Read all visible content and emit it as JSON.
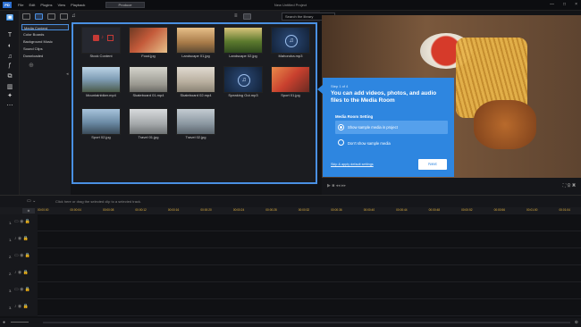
{
  "app": {
    "logo": "PD",
    "menu": [
      "File",
      "Edit",
      "Plugins",
      "View",
      "Playback"
    ],
    "produce_label": "Produce",
    "project_title": "New Untitled Project",
    "window_controls": [
      "—",
      "□",
      "×"
    ]
  },
  "library": {
    "search_placeholder": "Search the library",
    "rooms": [
      "Media Content",
      "Color Boards",
      "Background Music",
      "Sound Clips",
      "Downloaded"
    ],
    "selected_room": "Media Content",
    "items": [
      {
        "name": "Stock Content",
        "kind": "stock"
      },
      {
        "name": "Food.jpg",
        "kind": "image",
        "color": "#a84a32"
      },
      {
        "name": "Landscape 01.jpg",
        "kind": "image",
        "color": "#c79a5e"
      },
      {
        "name": "Landscape 02.jpg",
        "kind": "image",
        "color": "#6f8a3e"
      },
      {
        "name": "Mahoroba.mp3",
        "kind": "audio"
      },
      {
        "name": "Mountainbiker.mp4",
        "kind": "video",
        "color": "#8fb0c8"
      },
      {
        "name": "Skateboard 01.mp4",
        "kind": "video",
        "color": "#b9b9b0"
      },
      {
        "name": "Skateboard 02.mp4",
        "kind": "video",
        "color": "#c9c2b4"
      },
      {
        "name": "Speaking Out.mp3",
        "kind": "audio"
      },
      {
        "name": "Sport 01.jpg",
        "kind": "image",
        "color": "#d8573a"
      },
      {
        "name": "Sport 02.jpg",
        "kind": "image",
        "color": "#7fa3c4"
      },
      {
        "name": "Travel 01.jpg",
        "kind": "image",
        "color": "#b7b9ba"
      },
      {
        "name": "Travel 02.jpg",
        "kind": "image",
        "color": "#9aa6ad"
      }
    ]
  },
  "popup": {
    "step": "Step 1 of 4",
    "heading": "You can add videos, photos, and audio files to the Media Room",
    "setting_title": "Media Room Setting",
    "option_show": "Show sample media in project",
    "option_hide": "Don't show sample media",
    "selected_option": "show",
    "skip_link": "Skip & apply default settings",
    "next_label": "Next"
  },
  "timeline": {
    "hint": "Click here or drag the selected clip to a selected track.",
    "timecodes": [
      "00:00:00",
      "00:00:04",
      "00:00:08",
      "00:00:12",
      "00:00:16",
      "00:00:20",
      "00:00:24",
      "00:00:28",
      "00:00:32",
      "00:00:36",
      "00:00:40",
      "00:00:44",
      "00:00:48",
      "00:00:52",
      "00:00:56",
      "00:01:00",
      "00:01:04"
    ],
    "tracks": [
      "1.",
      "1.",
      "2.",
      "2.",
      "3.",
      "3."
    ]
  },
  "colors": {
    "accent": "#2e86e0",
    "panel_border": "#4a90e2",
    "background": "#121316"
  }
}
